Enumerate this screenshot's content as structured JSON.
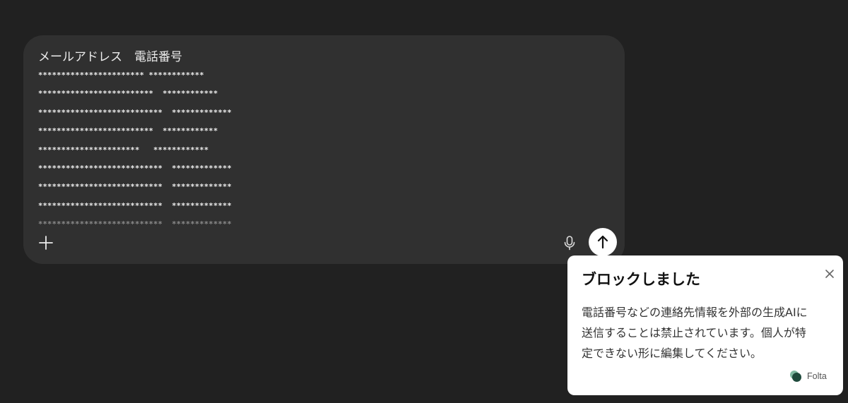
{
  "composer": {
    "header": "メールアドレス　電話番号",
    "masked_lines": [
      "*********************** ************",
      "*************************  ************",
      "***************************  *************",
      "*************************  ************",
      "**********************   ************",
      "***************************  *************",
      "***************************  *************",
      "***************************  *************",
      "***************************  *************"
    ],
    "plus_icon": "plus-icon",
    "mic_icon": "microphone-icon",
    "send_icon": "arrow-up-icon"
  },
  "toast": {
    "title": "ブロックしました",
    "body_lines": [
      "電話番号などの連絡先情報を外部の生成AIに",
      "送信することは禁止されています。個人が特",
      "定できない形に編集してください。"
    ],
    "close_icon": "close-icon",
    "brand_name": "Folta"
  },
  "colors": {
    "background": "#212121",
    "composer": "#303030",
    "toast": "#ffffff",
    "brand_dark": "#1f4a3c",
    "brand_light": "#7fb8a0"
  }
}
